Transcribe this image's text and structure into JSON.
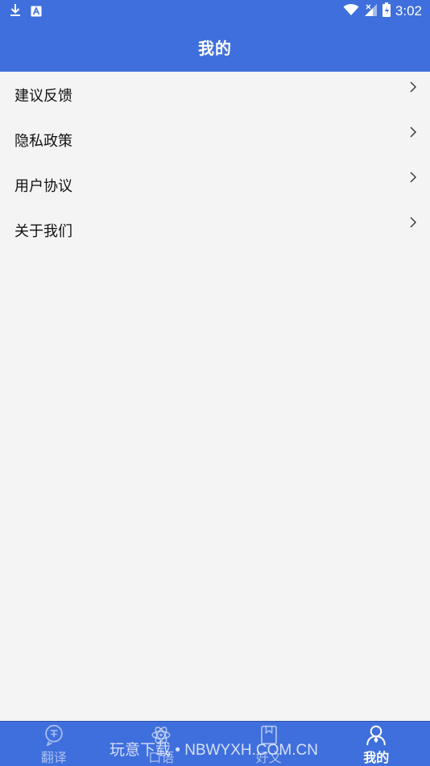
{
  "status_bar": {
    "time": "3:02",
    "icons": [
      "download-icon",
      "keyboard-a-icon",
      "wifi-icon",
      "signal-icon",
      "battery-icon"
    ]
  },
  "header": {
    "title": "我的"
  },
  "menu": {
    "items": [
      {
        "label": "建议反馈",
        "icon": "chevron-right-icon"
      },
      {
        "label": "隐私政策",
        "icon": "chevron-right-icon"
      },
      {
        "label": "用户协议",
        "icon": "chevron-right-icon"
      },
      {
        "label": "关于我们",
        "icon": "chevron-right-icon"
      }
    ]
  },
  "tabs": [
    {
      "label": "翻译",
      "icon": "translate-icon",
      "active": false
    },
    {
      "label": "口语",
      "icon": "atom-icon",
      "active": false
    },
    {
      "label": "好文",
      "icon": "bookmark-icon",
      "active": false
    },
    {
      "label": "我的",
      "icon": "user-icon",
      "active": true
    }
  ],
  "watermark": "玩意下载 • NBWYXH.COM.CN",
  "colors": {
    "primary": "#3f6fdc",
    "background": "#f4f4f4",
    "text": "#111111"
  }
}
